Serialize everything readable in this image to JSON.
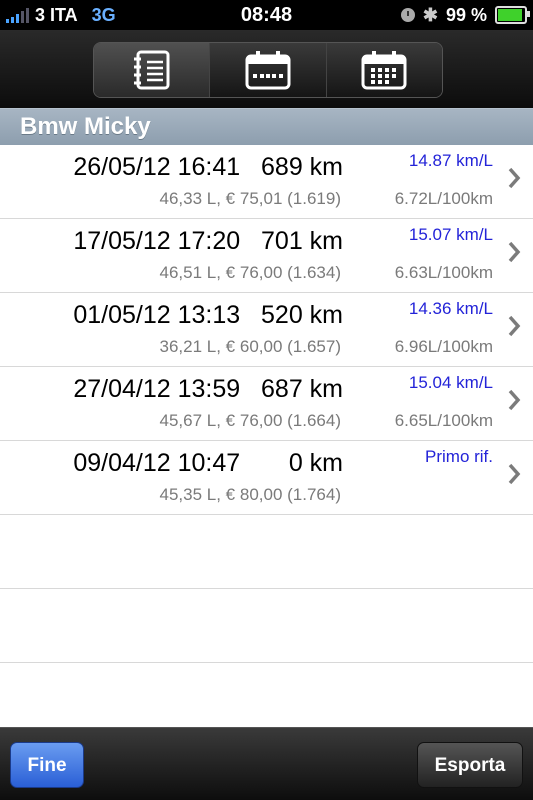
{
  "status_bar": {
    "carrier": "3 ITA",
    "network": "3G",
    "time": "08:48",
    "battery": "99 %"
  },
  "toolbar": {
    "segments": [
      {
        "icon": "notebook-icon"
      },
      {
        "icon": "calendar-week-icon"
      },
      {
        "icon": "calendar-month-icon"
      }
    ],
    "selected_index": 0
  },
  "section": {
    "title": "Bmw Micky"
  },
  "entries": [
    {
      "datetime": "26/05/12 16:41",
      "km": "689 km",
      "details": "46,33 L, € 75,01 (1.619)",
      "efficiency": "14.87 km/L",
      "consumption": "6.72L/100km"
    },
    {
      "datetime": "17/05/12 17:20",
      "km": "701 km",
      "details": "46,51 L, € 76,00 (1.634)",
      "efficiency": "15.07 km/L",
      "consumption": "6.63L/100km"
    },
    {
      "datetime": "01/05/12 13:13",
      "km": "520 km",
      "details": "36,21 L, € 60,00 (1.657)",
      "efficiency": "14.36 km/L",
      "consumption": "6.96L/100km"
    },
    {
      "datetime": "27/04/12 13:59",
      "km": "687 km",
      "details": "45,67 L, € 76,00 (1.664)",
      "efficiency": "15.04 km/L",
      "consumption": "6.65L/100km"
    },
    {
      "datetime": "09/04/12 10:47",
      "km": "0 km",
      "details": "45,35 L, € 80,00 (1.764)",
      "efficiency": "Primo rif.",
      "consumption": ""
    }
  ],
  "bottom_bar": {
    "fine_label": "Fine",
    "esporta_label": "Esporta"
  },
  "colors": {
    "efficiency_text": "#2323d8",
    "section_header": "#9aa9b8",
    "fine_button": "#2a5fd6"
  }
}
